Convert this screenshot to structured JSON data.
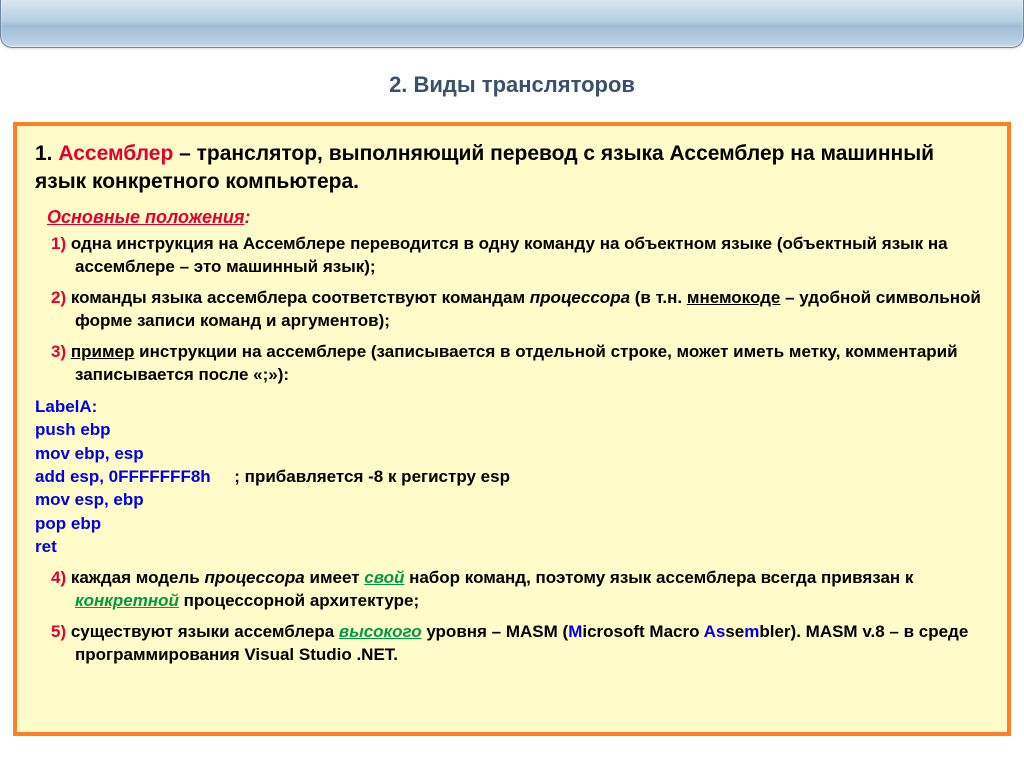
{
  "section_title": "2. Виды трансляторов",
  "definition": {
    "num": "1.",
    "term": "Ассемблер",
    "rest": " – транслятор, выполняющий перевод с языка Ассемблер на машинный язык конкретного компьютера."
  },
  "subtitle": "Основные положения",
  "subtitle_colon": ":",
  "points": {
    "p1": {
      "num": "1)",
      "text": " одна инструкция на Ассемблере переводится в одну команду на объектном языке (объектный язык на ассемблере – это машинный язык);"
    },
    "p2": {
      "num": "2)",
      "pre": " команды языка ассемблера соответствуют  командам ",
      "em1": "процессора",
      "mid": " (в т.н. ",
      "ul1": "мнемокоде",
      "rest": " – удобной символьной форме записи команд и аргументов);"
    },
    "p3": {
      "num": "3)",
      "pre": " ",
      "ul1": "пример",
      "rest": " инструкции на ассемблере (записывается в отдельной строке, может иметь метку, комментарий  записывается после «;»):"
    },
    "p4": {
      "num": "4)",
      "pre": " каждая модель ",
      "em1": "процессора",
      "mid1": " имеет ",
      "g1": "свой",
      "mid2": " набор команд, поэтому язык ассемблера всегда привязан к ",
      "g2": "конкретной",
      "rest": " процессорной архитектуре;"
    },
    "p5": {
      "num": "5)",
      "pre": " существуют  языки ассемблера ",
      "g1": "высокого",
      "mid1": " уровня – MASM (",
      "b1": "M",
      "mid2": "icrosoft Macro ",
      "b2": "As",
      "mid3": "se",
      "b3": "m",
      "mid4": "bler). MASM v.8 – в среде программирования Visual Studio .NET."
    }
  },
  "code": {
    "l1": "LabelA:",
    "l2": "push ebp",
    "l3": "mov ebp, esp",
    "l4a": "add esp, 0FFFFFFF8h     ",
    "l4b": "; прибавляется -8 к регистру esp",
    "l5": "mov esp, ebp",
    "l6": "pop ebp",
    "l7": "ret"
  }
}
